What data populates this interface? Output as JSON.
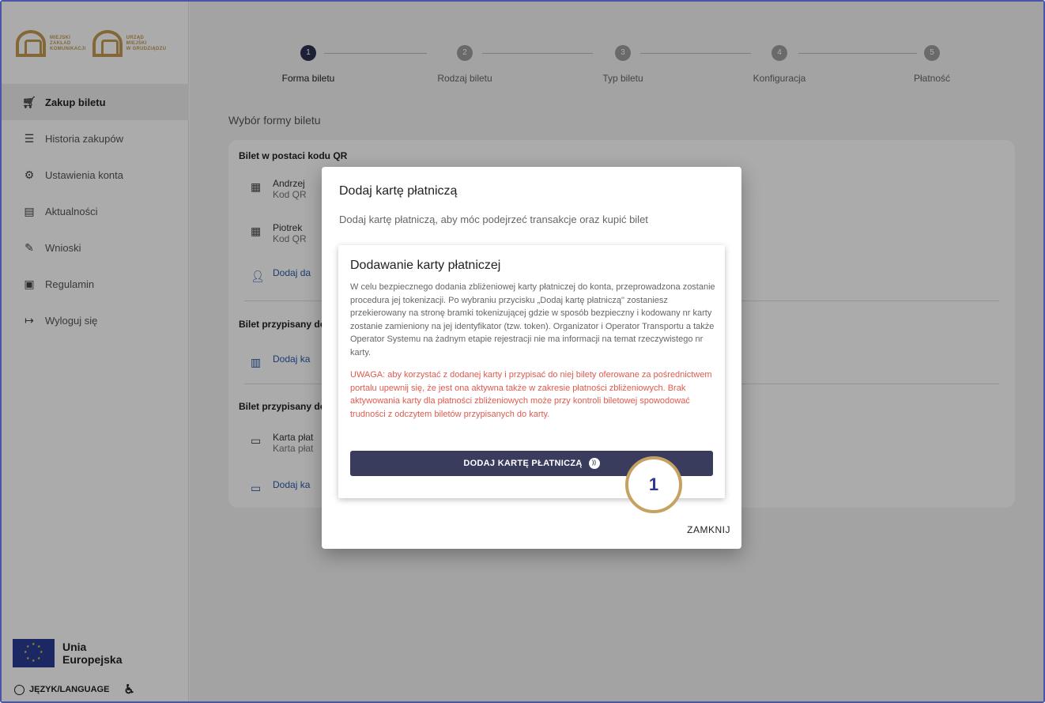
{
  "logos": [
    {
      "lines": [
        "MIEJSKI",
        "ZAKŁAD",
        "KOMUNIKACJI"
      ]
    },
    {
      "lines": [
        "URZĄD",
        "MIEJSKI",
        "W GRUDZIĄDZU"
      ]
    }
  ],
  "sidebar": {
    "items": [
      {
        "label": "Zakup biletu",
        "icon": "cart-icon",
        "active": true
      },
      {
        "label": "Historia zakupów",
        "icon": "list-icon"
      },
      {
        "label": "Ustawienia konta",
        "icon": "gear-icon"
      },
      {
        "label": "Aktualności",
        "icon": "news-icon"
      },
      {
        "label": "Wnioski",
        "icon": "form-icon"
      },
      {
        "label": "Regulamin",
        "icon": "rules-icon"
      },
      {
        "label": "Wyloguj się",
        "icon": "logout-icon"
      }
    ],
    "eu_line1": "Unia",
    "eu_line2": "Europejska",
    "language": "JĘZYK/LANGUAGE"
  },
  "stepper": {
    "steps": [
      {
        "number": "1",
        "label": "Forma biletu",
        "active": true
      },
      {
        "number": "2",
        "label": "Rodzaj biletu"
      },
      {
        "number": "3",
        "label": "Typ biletu"
      },
      {
        "number": "4",
        "label": "Konfiguracja"
      },
      {
        "number": "5",
        "label": "Płatność"
      }
    ]
  },
  "main": {
    "section_title": "Wybór formy biletu",
    "group_qr": "Bilet w postaci kodu QR",
    "qr_items": [
      {
        "name": "Andrzej",
        "sub": "Kod QR"
      },
      {
        "name": "Piotrek",
        "sub": "Kod QR"
      }
    ],
    "add_qr": "Dodaj da",
    "group_city": "Bilet przypisany do",
    "add_city": "Dodaj ka",
    "group_card": "Bilet przypisany do",
    "card_item": {
      "name": "Karta płat",
      "sub": "Karta płat"
    },
    "add_card": "Dodaj ka"
  },
  "dialog": {
    "title": "Dodaj kartę płatniczą",
    "subtitle": "Dodaj kartę płatniczą, aby móc podejrzeć transakcje oraz kupić bilet",
    "inner_title": "Dodawanie karty płatniczej",
    "inner_body": "W celu bezpiecznego dodania zbliżeniowej karty płatniczej do konta, przeprowadzona zostanie procedura jej tokenizacji. Po wybraniu przycisku „Dodaj kartę płatniczą\" zostaniesz przekierowany na stronę bramki tokenizującej gdzie w sposób bezpieczny i kodowany nr karty zostanie zamieniony na jej identyfikator (tzw. token). Organizator i Operator Transportu a także Operator Systemu na żadnym etapie rejestracji nie ma informacji na temat rzeczywistego nr karty.",
    "inner_warning": "UWAGA: aby korzystać z dodanej karty i przypisać do niej bilety oferowane za pośrednictwem portalu upewnij się, że jest ona aktywna także w zakresie płatności zbliżeniowych. Brak aktywowania karty dla płatności zbliżeniowych może przy kontroli biletowej spowodować trudności z odczytem biletów przypisanych do karty.",
    "add_button": "DODAJ KARTĘ PŁATNICZĄ",
    "close_button": "ZAMKNIJ"
  },
  "marker": "1"
}
